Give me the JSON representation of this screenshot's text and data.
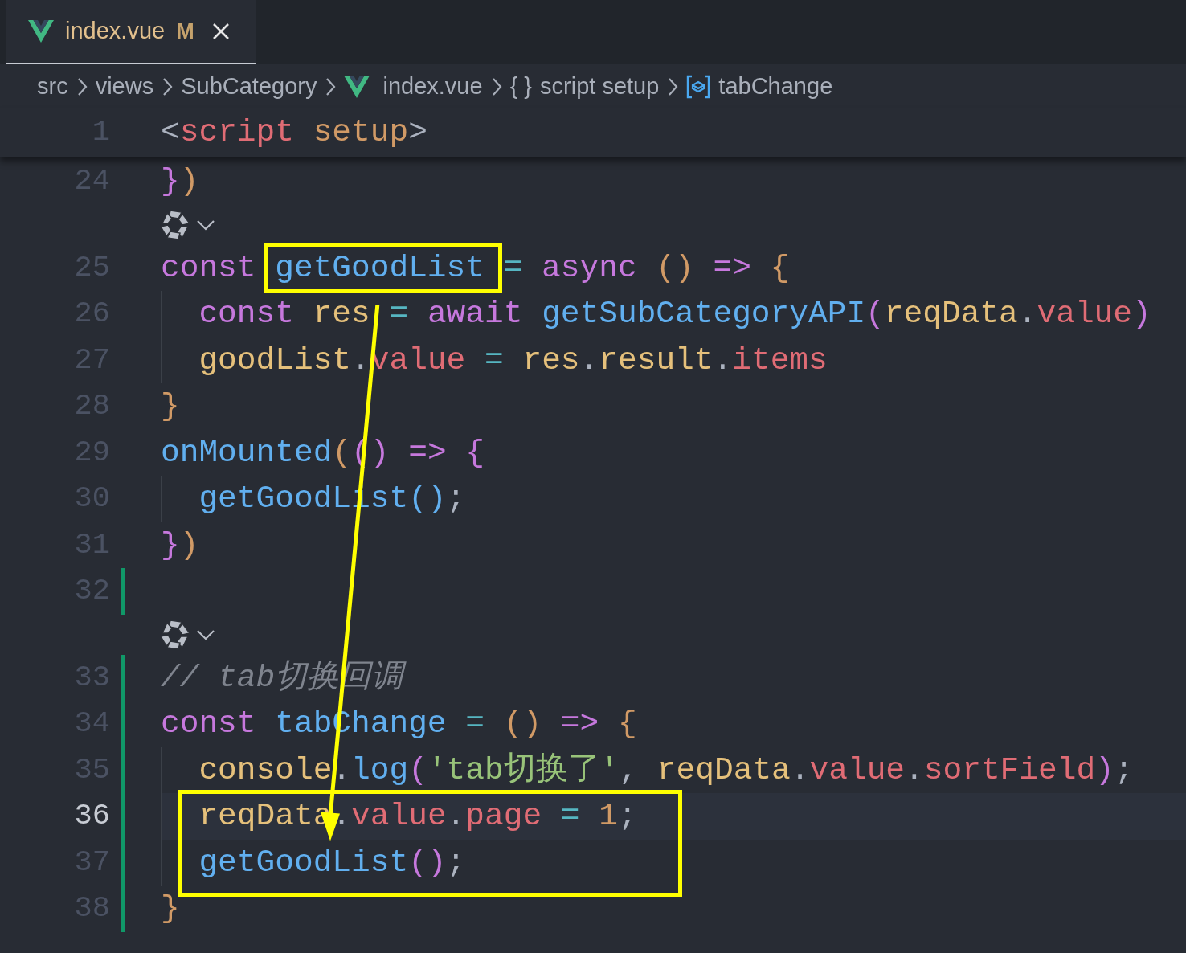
{
  "tab": {
    "title": "index.vue",
    "badge": "M",
    "modified": true,
    "selected": true
  },
  "breadcrumbs": [
    {
      "label": "src",
      "kind": "folder"
    },
    {
      "label": "views",
      "kind": "folder"
    },
    {
      "label": "SubCategory",
      "kind": "folder"
    },
    {
      "label": "index.vue",
      "kind": "vue-file"
    },
    {
      "label": "script setup",
      "kind": "block",
      "icon_text": "{ }"
    },
    {
      "label": "tabChange",
      "kind": "symbol"
    }
  ],
  "sticky_line": {
    "number": "1",
    "tokens": [
      {
        "text": "<",
        "kind": "punct"
      },
      {
        "text": "script ",
        "kind": "tag"
      },
      {
        "text": "setup",
        "kind": "attr"
      },
      {
        "text": ">",
        "kind": "punct"
      }
    ]
  },
  "lines": [
    {
      "kind": "code",
      "number": "24",
      "changed": false,
      "current": false,
      "boxed": false,
      "indented": false,
      "tokens": [
        {
          "text": "}",
          "kind": "b2"
        },
        {
          "text": ")",
          "kind": "b1"
        }
      ]
    },
    {
      "kind": "codelens"
    },
    {
      "kind": "code",
      "number": "25",
      "changed": false,
      "current": false,
      "boxed": false,
      "indented": false,
      "tokens": [
        {
          "text": "const ",
          "kind": "keyword"
        },
        {
          "text": "getGoodList",
          "kind": "func",
          "boxed": true
        },
        {
          "text": " = ",
          "kind": "op"
        },
        {
          "text": "async ",
          "kind": "keyword"
        },
        {
          "text": "()",
          "kind": "b1"
        },
        {
          "text": " => ",
          "kind": "keyword"
        },
        {
          "text": "{",
          "kind": "b1"
        }
      ]
    },
    {
      "kind": "code",
      "number": "26",
      "changed": false,
      "current": false,
      "boxed": false,
      "indented": true,
      "tokens": [
        {
          "text": "const ",
          "kind": "keyword"
        },
        {
          "text": "res ",
          "kind": "var"
        },
        {
          "text": "= ",
          "kind": "op"
        },
        {
          "text": "await ",
          "kind": "keyword"
        },
        {
          "text": "getSubCategoryAPI",
          "kind": "func"
        },
        {
          "text": "(",
          "kind": "b2"
        },
        {
          "text": "reqData",
          "kind": "var"
        },
        {
          "text": ".",
          "kind": "punct"
        },
        {
          "text": "value",
          "kind": "prop"
        },
        {
          "text": ")",
          "kind": "b2"
        }
      ]
    },
    {
      "kind": "code",
      "number": "27",
      "changed": false,
      "current": false,
      "boxed": false,
      "indented": true,
      "tokens": [
        {
          "text": "goodList",
          "kind": "var"
        },
        {
          "text": ".",
          "kind": "punct"
        },
        {
          "text": "value",
          "kind": "prop"
        },
        {
          "text": " = ",
          "kind": "op"
        },
        {
          "text": "res",
          "kind": "var"
        },
        {
          "text": ".",
          "kind": "punct"
        },
        {
          "text": "result",
          "kind": "var"
        },
        {
          "text": ".",
          "kind": "punct"
        },
        {
          "text": "items",
          "kind": "prop"
        }
      ]
    },
    {
      "kind": "code",
      "number": "28",
      "changed": false,
      "current": false,
      "boxed": false,
      "indented": false,
      "tokens": [
        {
          "text": "}",
          "kind": "b1"
        }
      ]
    },
    {
      "kind": "code",
      "number": "29",
      "changed": false,
      "current": false,
      "boxed": false,
      "indented": false,
      "tokens": [
        {
          "text": "onMounted",
          "kind": "func"
        },
        {
          "text": "(",
          "kind": "b1"
        },
        {
          "text": "()",
          "kind": "b2"
        },
        {
          "text": " => ",
          "kind": "keyword"
        },
        {
          "text": "{",
          "kind": "b2"
        }
      ]
    },
    {
      "kind": "code",
      "number": "30",
      "changed": false,
      "current": false,
      "boxed": false,
      "indented": true,
      "tokens": [
        {
          "text": "getGoodList",
          "kind": "func"
        },
        {
          "text": "()",
          "kind": "b3"
        },
        {
          "text": ";",
          "kind": "punct"
        }
      ]
    },
    {
      "kind": "code",
      "number": "31",
      "changed": false,
      "current": false,
      "boxed": false,
      "indented": false,
      "tokens": [
        {
          "text": "}",
          "kind": "b2"
        },
        {
          "text": ")",
          "kind": "b1"
        }
      ]
    },
    {
      "kind": "code",
      "number": "32",
      "changed": true,
      "current": false,
      "boxed": false,
      "indented": false
    },
    {
      "kind": "codelens"
    },
    {
      "kind": "code",
      "number": "33",
      "changed": true,
      "current": false,
      "boxed": false,
      "indented": false,
      "tokens": [
        {
          "text": "// tab切换回调",
          "kind": "comment"
        }
      ]
    },
    {
      "kind": "code",
      "number": "34",
      "changed": true,
      "current": false,
      "boxed": false,
      "indented": false,
      "tokens": [
        {
          "text": "const ",
          "kind": "keyword"
        },
        {
          "text": "tabChange",
          "kind": "func"
        },
        {
          "text": " = ",
          "kind": "op"
        },
        {
          "text": "()",
          "kind": "b1"
        },
        {
          "text": " => ",
          "kind": "keyword"
        },
        {
          "text": "{",
          "kind": "b1"
        }
      ]
    },
    {
      "kind": "code",
      "number": "35",
      "changed": true,
      "current": false,
      "boxed": false,
      "indented": true,
      "tokens": [
        {
          "text": "console",
          "kind": "var"
        },
        {
          "text": ".",
          "kind": "punct"
        },
        {
          "text": "log",
          "kind": "func"
        },
        {
          "text": "(",
          "kind": "b2"
        },
        {
          "text": "'tab切换了'",
          "kind": "str"
        },
        {
          "text": ", ",
          "kind": "punct"
        },
        {
          "text": "reqData",
          "kind": "var"
        },
        {
          "text": ".",
          "kind": "punct"
        },
        {
          "text": "value",
          "kind": "prop"
        },
        {
          "text": ".",
          "kind": "punct"
        },
        {
          "text": "sortField",
          "kind": "prop"
        },
        {
          "text": ")",
          "kind": "b2"
        },
        {
          "text": ";",
          "kind": "punct"
        }
      ]
    },
    {
      "kind": "code",
      "number": "36",
      "changed": true,
      "current": true,
      "boxed": true,
      "indented": true,
      "tokens": [
        {
          "text": "reqData",
          "kind": "var"
        },
        {
          "text": ".",
          "kind": "punct"
        },
        {
          "text": "value",
          "kind": "prop"
        },
        {
          "text": ".",
          "kind": "punct"
        },
        {
          "text": "page",
          "kind": "prop"
        },
        {
          "text": " = ",
          "kind": "op"
        },
        {
          "text": "1",
          "kind": "num"
        },
        {
          "text": ";",
          "kind": "punct"
        }
      ]
    },
    {
      "kind": "code",
      "number": "37",
      "changed": true,
      "current": false,
      "boxed": true,
      "indented": true,
      "tokens": [
        {
          "text": "getGoodList",
          "kind": "func"
        },
        {
          "text": "()",
          "kind": "b2"
        },
        {
          "text": ";",
          "kind": "punct"
        }
      ]
    },
    {
      "kind": "code",
      "number": "38",
      "changed": true,
      "current": false,
      "boxed": false,
      "indented": false,
      "tokens": [
        {
          "text": "}",
          "kind": "b1"
        }
      ]
    }
  ],
  "callout_arrow": true
}
